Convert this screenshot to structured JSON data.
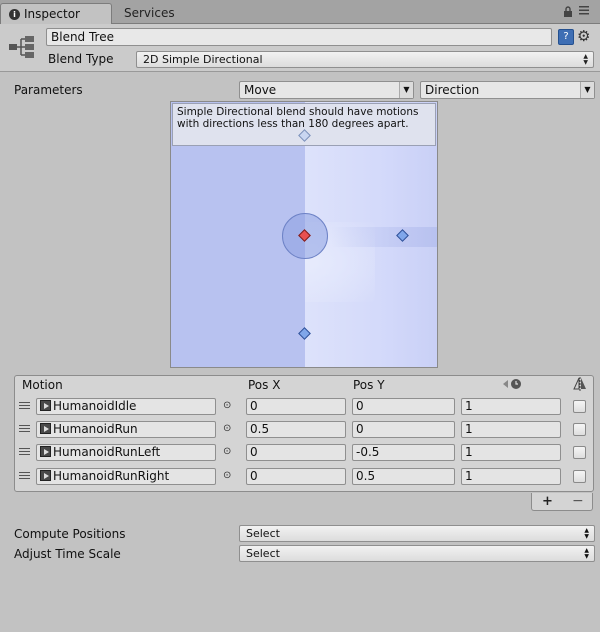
{
  "tabs": [
    {
      "label": "Inspector",
      "active": true
    },
    {
      "label": "Services",
      "active": false
    }
  ],
  "header": {
    "name_value": "Blend Tree",
    "blend_type_label": "Blend Type",
    "blend_type_value": "2D Simple Directional",
    "help_glyph": "?",
    "gear_glyph": "⚙"
  },
  "parameters": {
    "label": "Parameters",
    "x_param": "Move",
    "y_param": "Direction"
  },
  "blend_view": {
    "warning": "Simple Directional blend should have motions with directions less than 180 degrees apart.",
    "colors": {
      "left": "#b8c2f0",
      "right": "#dde2fb",
      "current": "#e85050",
      "motion": "#7fa6ea"
    }
  },
  "motion_table": {
    "headers": {
      "motion": "Motion",
      "pos_x": "Pos X",
      "pos_y": "Pos Y"
    },
    "rows": [
      {
        "motion": "HumanoidIdle",
        "pos_x": "0",
        "pos_y": "0",
        "speed": "1",
        "mirror": false
      },
      {
        "motion": "HumanoidRun",
        "pos_x": "0.5",
        "pos_y": "0",
        "speed": "1",
        "mirror": false
      },
      {
        "motion": "HumanoidRunLeft",
        "pos_x": "0",
        "pos_y": "-0.5",
        "speed": "1",
        "mirror": false
      },
      {
        "motion": "HumanoidRunRight",
        "pos_x": "0",
        "pos_y": "0.5",
        "speed": "1",
        "mirror": false
      }
    ],
    "add_label": "+",
    "remove_label": "−"
  },
  "settings": {
    "compute_label": "Compute Positions",
    "compute_value": "Select",
    "adjust_label": "Adjust Time Scale",
    "adjust_value": "Select"
  }
}
